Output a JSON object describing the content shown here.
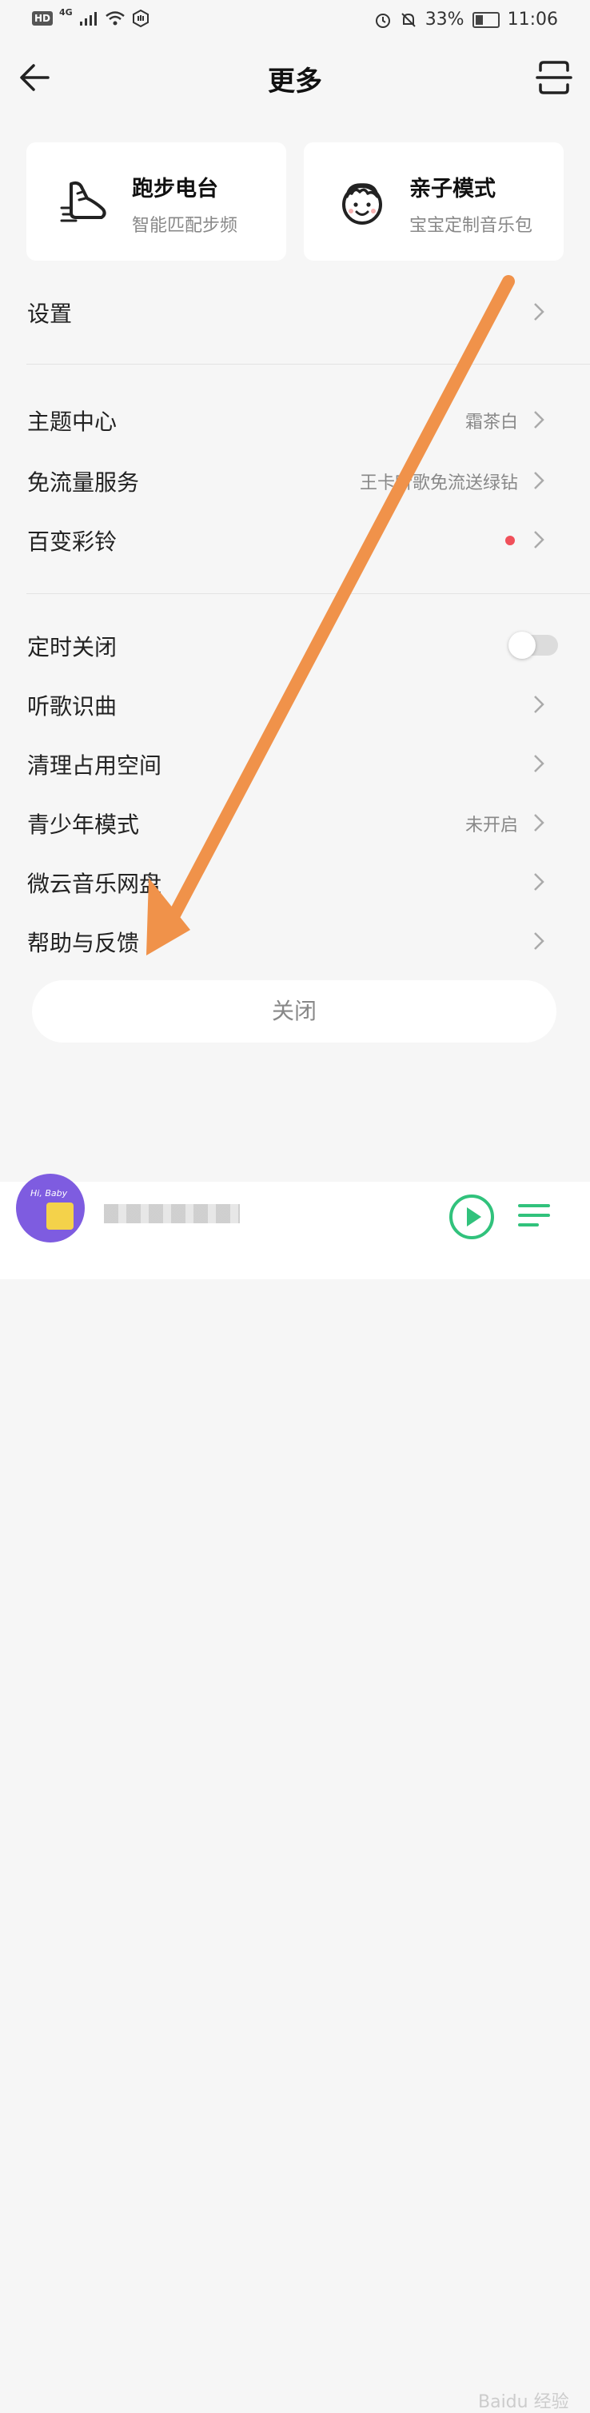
{
  "status_bar": {
    "hd": "HD",
    "network": "4G",
    "battery": "33%",
    "time": "11:06"
  },
  "header": {
    "title": "更多"
  },
  "cards": [
    {
      "title": "跑步电台",
      "subtitle": "智能匹配步频",
      "icon": "running-shoe-icon"
    },
    {
      "title": "亲子模式",
      "subtitle": "宝宝定制音乐包",
      "icon": "baby-face-icon"
    }
  ],
  "menu": {
    "settings": {
      "label": "设置"
    },
    "theme": {
      "label": "主题中心",
      "value": "霜茶白"
    },
    "data_free": {
      "label": "免流量服务",
      "value": "王卡听歌免流送绿钻"
    },
    "ringtone": {
      "label": "百变彩铃"
    },
    "sleep_timer": {
      "label": "定时关闭"
    },
    "song_recognition": {
      "label": "听歌识曲"
    },
    "clean_storage": {
      "label": "清理占用空间"
    },
    "teen_mode": {
      "label": "青少年模式",
      "value": "未开启"
    },
    "weiyun": {
      "label": "微云音乐网盘"
    },
    "help": {
      "label": "帮助与反馈"
    }
  },
  "close_button": {
    "label": "关闭"
  },
  "player": {
    "avatar_text": "Hi, Baby"
  },
  "watermark": "Baidu 经验",
  "colors": {
    "accent_green": "#31c27c",
    "annotation_arrow": "#f0924a",
    "red_dot": "#f0505a"
  }
}
